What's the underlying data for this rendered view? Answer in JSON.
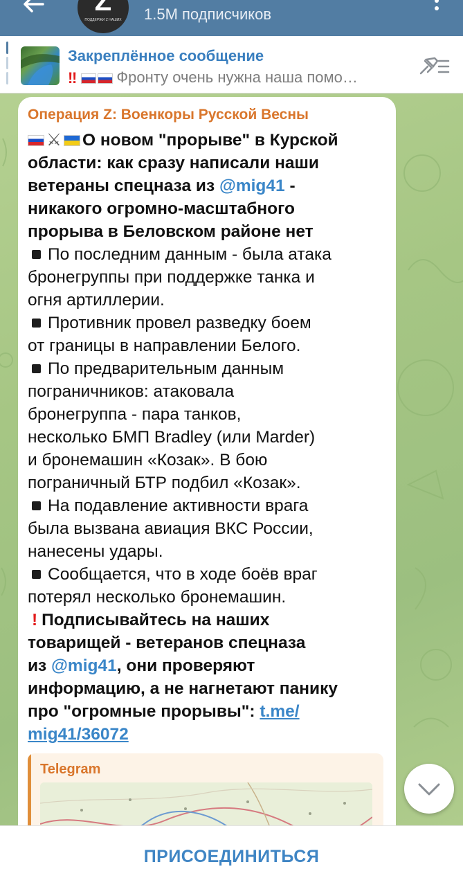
{
  "header": {
    "subscribers": "1.5M подписчиков",
    "avatar_letter": "Z",
    "avatar_caption": "ПОДДЕРЖИ Z НАШИХ"
  },
  "pinned": {
    "title": "Закреплённое сообщение",
    "preview_text": "‼️🇷🇺🇷🇺Фронту очень нужна наша помо…",
    "preview_tail": "Фронту очень нужна наша помо…"
  },
  "message": {
    "author": "Операция Z: Военкоры Русской Весны",
    "headline_1": "О новом \"прорыве\" в Курской",
    "headline_2": "области: как сразу написали наши",
    "headline_3a": "ветераны спецназа из ",
    "headline_3_mention": "@mig41",
    "headline_3b": " -",
    "headline_4": "никакого огромно-масштабного",
    "headline_5": "прорыва в Беловском районе нет",
    "b1_1": "По последним данным - была атака",
    "b1_2": "бронегруппы при поддержке танка и",
    "b1_3": "огня артиллерии.",
    "b2_1": "Противник провел разведку боем",
    "b2_2": "от границы в направлении Белого.",
    "b3_1": "По предварительным данным",
    "b3_2": "пограничников: атаковала",
    "b3_3": "бронегруппа - пара танков,",
    "b3_4": "несколько БМП Bradley (или Marder)",
    "b3_5": "и бронемашин «Козак». В бою",
    "b3_6": "пограничный БТР подбил «Козак».",
    "b4_1": "На подавление активности врага",
    "b4_2": "была вызвана авиация ВКС России,",
    "b4_3": "нанесены удары.",
    "b5_1": "Сообщается, что в ходе боёв враг",
    "b5_2": "потерял несколько бронемашин.",
    "cta_1": "Подписывайтесь на наших",
    "cta_2": "товарищей - ветеранов спецназа",
    "cta_3a": "из ",
    "cta_3_mention": "@mig41",
    "cta_3b": ", они проверяют",
    "cta_4": "информацию, а не нагнетают панику",
    "cta_5a": "про \"огромные прорывы\": ",
    "cta_5_link": "t.me/",
    "cta_6_link": "mig41/36072"
  },
  "link_preview": {
    "site": "Telegram"
  },
  "join_bar": {
    "label": "ПРИСОЕДИНИТЬСЯ"
  },
  "colors": {
    "header": "#527da3",
    "author": "#d9762c",
    "link": "#3a86c8",
    "join": "#3f85c4"
  }
}
